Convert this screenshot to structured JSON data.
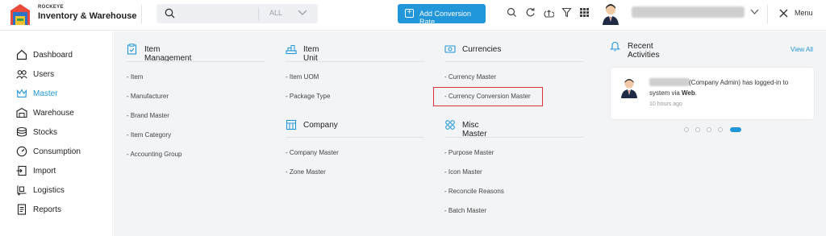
{
  "brand": {
    "company": "ROCKEYE",
    "app_name": "Inventory & Warehouse"
  },
  "search": {
    "placeholder": "",
    "scope": "ALL"
  },
  "header": {
    "add_button": "Add Conversion Rate",
    "menu_label": "Menu"
  },
  "sidebar": {
    "items": [
      {
        "label": "Dashboard",
        "icon": "home-icon"
      },
      {
        "label": "Users",
        "icon": "users-icon"
      },
      {
        "label": "Master",
        "icon": "crown-icon",
        "active": true
      },
      {
        "label": "Warehouse",
        "icon": "warehouse-icon"
      },
      {
        "label": "Stocks",
        "icon": "stocks-icon"
      },
      {
        "label": "Consumption",
        "icon": "gauge-icon"
      },
      {
        "label": "Import",
        "icon": "import-icon"
      },
      {
        "label": "Logistics",
        "icon": "logistics-icon"
      },
      {
        "label": "Reports",
        "icon": "reports-icon"
      }
    ]
  },
  "master_menu": {
    "item_management": {
      "title": "Item Management",
      "links": [
        "- Item",
        "- Manufacturer",
        "- Brand Master",
        "- Item Category",
        "- Accounting Group"
      ]
    },
    "item_unit": {
      "title": "Item Unit",
      "links": [
        "- Item UOM",
        "- Package Type"
      ]
    },
    "company": {
      "title": "Company",
      "links": [
        "- Company Master",
        "- Zone Master"
      ]
    },
    "currencies": {
      "title": "Currencies",
      "links": [
        "- Currency Master",
        "- Currency Conversion Master"
      ]
    },
    "misc_master": {
      "title": "Misc Master",
      "links": [
        "- Purpose Master",
        "- Icon Master",
        "- Reconcile Reasons",
        "- Batch Master"
      ]
    }
  },
  "recent_activities": {
    "title": "Recent Activities",
    "view_all": "View All",
    "activity": {
      "line1": "(Company Admin) has logged-in to",
      "line2_prefix": "system via ",
      "line2_bold": "Web",
      "line2_suffix": ".",
      "time": "10 hours ago"
    },
    "carousel_active_index": 4,
    "carousel_count": 5
  },
  "colors": {
    "accent": "#2196d9",
    "highlight": "#e0313a",
    "panel_bg": "#f3f4f6"
  }
}
